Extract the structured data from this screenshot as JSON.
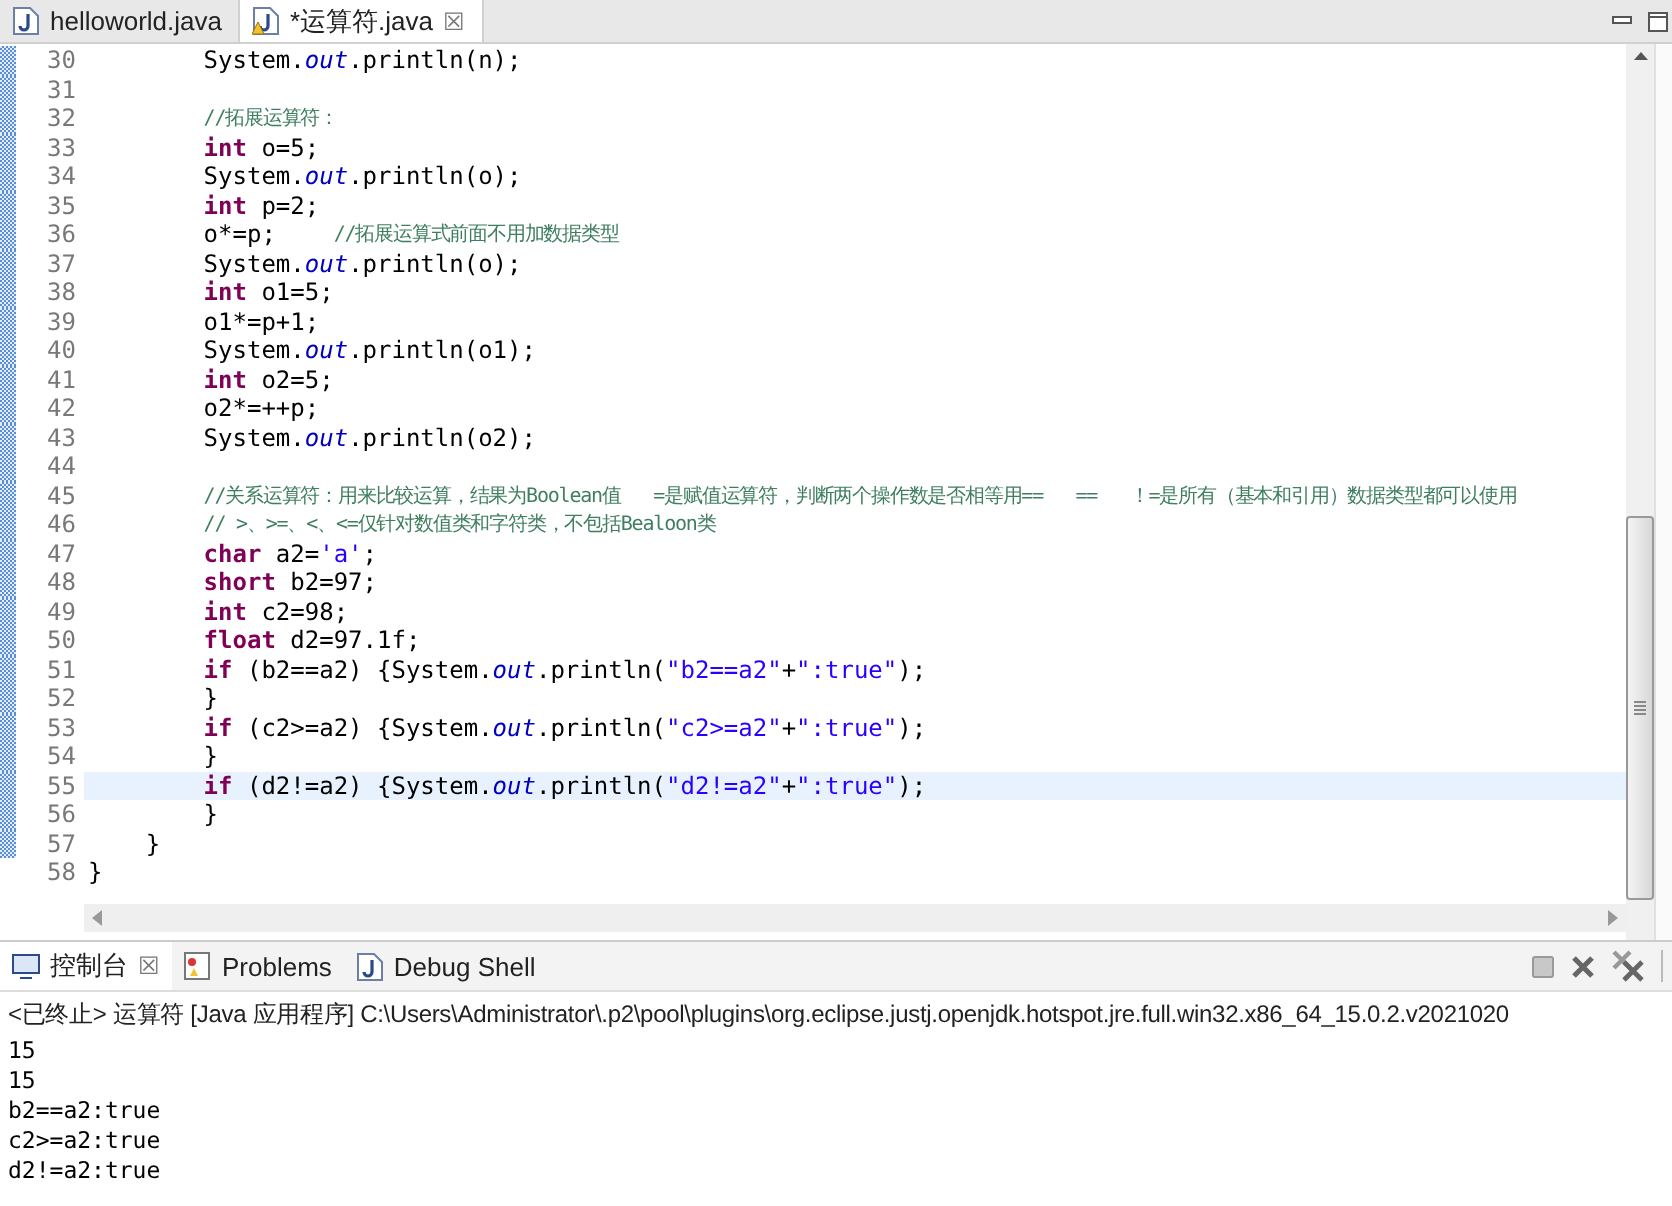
{
  "editor_tabs": [
    {
      "label": "helloworld.java",
      "selected": false,
      "warning": false,
      "closable": false
    },
    {
      "label": "*运算符.java",
      "selected": true,
      "warning": true,
      "closable": true
    }
  ],
  "close_glyph": "☒",
  "code_lines": [
    {
      "number": "30",
      "changed": true,
      "current": false,
      "tokens": [
        {
          "kind": "plain",
          "text": "        System."
        },
        {
          "kind": "field",
          "text": "out"
        },
        {
          "kind": "plain",
          "text": ".println(n);"
        }
      ]
    },
    {
      "number": "31",
      "changed": true,
      "current": false
    },
    {
      "number": "32",
      "changed": true,
      "current": false,
      "tokens": [
        {
          "kind": "comment",
          "text": "        //拓展运算符："
        }
      ]
    },
    {
      "number": "33",
      "changed": true,
      "current": false,
      "tokens": [
        {
          "kind": "keyword",
          "text": "        int"
        },
        {
          "kind": "plain",
          "text": " o=5;"
        }
      ]
    },
    {
      "number": "34",
      "changed": true,
      "current": false,
      "tokens": [
        {
          "kind": "plain",
          "text": "        System."
        },
        {
          "kind": "field",
          "text": "out"
        },
        {
          "kind": "plain",
          "text": ".println(o);"
        }
      ]
    },
    {
      "number": "35",
      "changed": true,
      "current": false,
      "tokens": [
        {
          "kind": "keyword",
          "text": "        int"
        },
        {
          "kind": "plain",
          "text": " p=2;"
        }
      ]
    },
    {
      "number": "36",
      "changed": true,
      "current": false,
      "tokens": [
        {
          "kind": "plain",
          "text": "        o*=p;    "
        },
        {
          "kind": "comment",
          "text": "//拓展运算式前面不用加数据类型"
        }
      ]
    },
    {
      "number": "37",
      "changed": true,
      "current": false,
      "tokens": [
        {
          "kind": "plain",
          "text": "        System."
        },
        {
          "kind": "field",
          "text": "out"
        },
        {
          "kind": "plain",
          "text": ".println(o);"
        }
      ]
    },
    {
      "number": "38",
      "changed": true,
      "current": false,
      "tokens": [
        {
          "kind": "keyword",
          "text": "        int"
        },
        {
          "kind": "plain",
          "text": " o1=5;"
        }
      ]
    },
    {
      "number": "39",
      "changed": true,
      "current": false,
      "tokens": [
        {
          "kind": "plain",
          "text": "        o1*=p+1;"
        }
      ]
    },
    {
      "number": "40",
      "changed": true,
      "current": false,
      "tokens": [
        {
          "kind": "plain",
          "text": "        System."
        },
        {
          "kind": "field",
          "text": "out"
        },
        {
          "kind": "plain",
          "text": ".println(o1);"
        }
      ]
    },
    {
      "number": "41",
      "changed": true,
      "current": false,
      "tokens": [
        {
          "kind": "keyword",
          "text": "        int"
        },
        {
          "kind": "plain",
          "text": " o2=5;"
        }
      ]
    },
    {
      "number": "42",
      "changed": true,
      "current": false,
      "tokens": [
        {
          "kind": "plain",
          "text": "        o2*=++p;"
        }
      ]
    },
    {
      "number": "43",
      "changed": true,
      "current": false,
      "tokens": [
        {
          "kind": "plain",
          "text": "        System."
        },
        {
          "kind": "field",
          "text": "out"
        },
        {
          "kind": "plain",
          "text": ".println(o2);"
        }
      ]
    },
    {
      "number": "44",
      "changed": true,
      "current": false
    },
    {
      "number": "45",
      "changed": true,
      "current": false,
      "tokens": [
        {
          "kind": "comment",
          "text": "        //关系运算符：用来比较运算，结果为Boolean值   =是赋值运算符，判断两个操作数是否相等用==   ==   ！=是所有（基本和引用）数据类型都可以使用"
        }
      ]
    },
    {
      "number": "46",
      "changed": true,
      "current": false,
      "tokens": [
        {
          "kind": "comment",
          "text": "        // >、>=、<、<=仅针对数值类和字符类，不包括Bealoon类"
        }
      ]
    },
    {
      "number": "47",
      "changed": true,
      "current": false,
      "tokens": [
        {
          "kind": "keyword",
          "text": "        char"
        },
        {
          "kind": "plain",
          "text": " a2="
        },
        {
          "kind": "string",
          "text": "'a'"
        },
        {
          "kind": "plain",
          "text": ";"
        }
      ]
    },
    {
      "number": "48",
      "changed": true,
      "current": false,
      "tokens": [
        {
          "kind": "keyword",
          "text": "        short"
        },
        {
          "kind": "plain",
          "text": " b2=97;"
        }
      ]
    },
    {
      "number": "49",
      "changed": true,
      "current": false,
      "tokens": [
        {
          "kind": "keyword",
          "text": "        int"
        },
        {
          "kind": "plain",
          "text": " c2=98;"
        }
      ]
    },
    {
      "number": "50",
      "changed": true,
      "current": false,
      "tokens": [
        {
          "kind": "keyword",
          "text": "        float"
        },
        {
          "kind": "plain",
          "text": " d2=97.1f;"
        }
      ]
    },
    {
      "number": "51",
      "changed": true,
      "current": false,
      "tokens": [
        {
          "kind": "keyword",
          "text": "        if"
        },
        {
          "kind": "plain",
          "text": " (b2==a2) {System."
        },
        {
          "kind": "field",
          "text": "out"
        },
        {
          "kind": "plain",
          "text": ".println("
        },
        {
          "kind": "string",
          "text": "\"b2==a2\""
        },
        {
          "kind": "plain",
          "text": "+"
        },
        {
          "kind": "string",
          "text": "\":true\""
        },
        {
          "kind": "plain",
          "text": ");"
        }
      ]
    },
    {
      "number": "52",
      "changed": true,
      "current": false,
      "tokens": [
        {
          "kind": "plain",
          "text": "        }"
        }
      ]
    },
    {
      "number": "53",
      "changed": true,
      "current": false,
      "tokens": [
        {
          "kind": "keyword",
          "text": "        if"
        },
        {
          "kind": "plain",
          "text": " (c2>=a2) {System."
        },
        {
          "kind": "field",
          "text": "out"
        },
        {
          "kind": "plain",
          "text": ".println("
        },
        {
          "kind": "string",
          "text": "\"c2>=a2\""
        },
        {
          "kind": "plain",
          "text": "+"
        },
        {
          "kind": "string",
          "text": "\":true\""
        },
        {
          "kind": "plain",
          "text": ");"
        }
      ]
    },
    {
      "number": "54",
      "changed": true,
      "current": false,
      "tokens": [
        {
          "kind": "plain",
          "text": "        }"
        }
      ]
    },
    {
      "number": "55",
      "changed": true,
      "current": true,
      "tokens": [
        {
          "kind": "keyword",
          "text": "        if"
        },
        {
          "kind": "plain",
          "text": " (d2!=a2) {System."
        },
        {
          "kind": "field",
          "text": "out"
        },
        {
          "kind": "plain",
          "text": ".println("
        },
        {
          "kind": "string",
          "text": "\"d2!=a2\""
        },
        {
          "kind": "plain",
          "text": "+"
        },
        {
          "kind": "string",
          "text": "\":true\""
        },
        {
          "kind": "plain",
          "text": ");"
        }
      ]
    },
    {
      "number": "56",
      "changed": true,
      "current": false,
      "tokens": [
        {
          "kind": "plain",
          "text": "        }"
        }
      ]
    },
    {
      "number": "57",
      "changed": true,
      "current": false,
      "tokens": [
        {
          "kind": "plain",
          "text": "    }"
        }
      ]
    },
    {
      "number": "58",
      "changed": false,
      "current": false,
      "tokens": [
        {
          "kind": "plain",
          "text": "}"
        }
      ]
    }
  ],
  "console_tabs": [
    {
      "label": "控制台",
      "selected": true,
      "closable": true
    },
    {
      "label": "Problems",
      "selected": false,
      "closable": false
    },
    {
      "label": "Debug Shell",
      "selected": false,
      "closable": false
    }
  ],
  "console_status": "<已终止> 运算符 [Java 应用程序] C:\\Users\\Administrator\\.p2\\pool\\plugins\\org.eclipse.justj.openjdk.hotspot.jre.full.win32.x86_64_15.0.2.v2021020",
  "console_output": [
    "15",
    "15",
    "b2==a2:true",
    "c2>=a2:true",
    "d2!=a2:true"
  ]
}
